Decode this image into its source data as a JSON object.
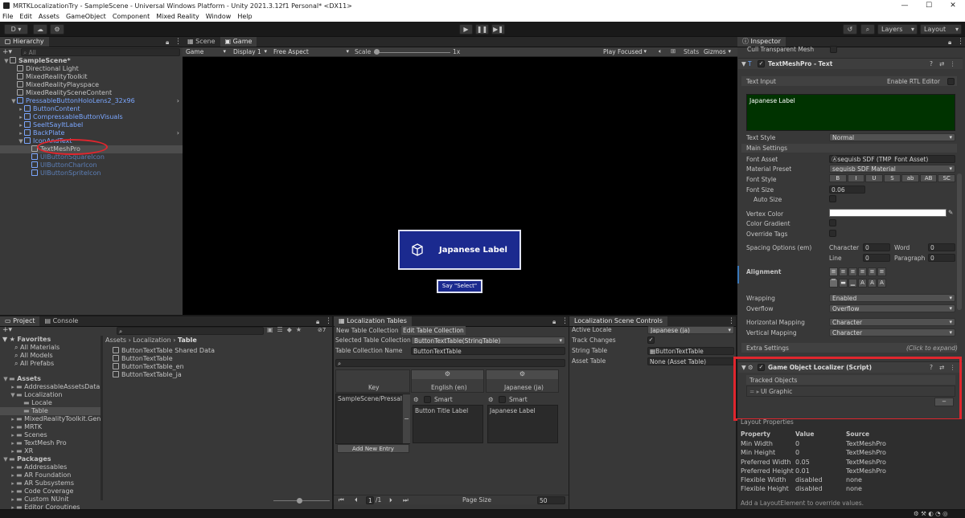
{
  "titlebar": {
    "title": "MRTKLocalizationTry - SampleScene - Universal Windows Platform - Unity 2021.3.12f1 Personal* <DX11>",
    "min": "—",
    "max": "☐",
    "close": "✕"
  },
  "menu": [
    "File",
    "Edit",
    "Assets",
    "GameObject",
    "Component",
    "Mixed Reality",
    "Window",
    "Help"
  ],
  "toolbar": {
    "account": "D ▾",
    "play": "▶",
    "pause": "❚❚",
    "step": "▶❚",
    "layers": "Layers",
    "layout": "Layout"
  },
  "hierarchy": {
    "tab": "Hierarchy",
    "search_placeholder": "All",
    "items": [
      {
        "label": "SampleScene*",
        "depth": 0,
        "color": "white",
        "bold": true
      },
      {
        "label": "Directional Light",
        "depth": 1,
        "color": "white"
      },
      {
        "label": "MixedRealityToolkit",
        "depth": 1,
        "color": "white"
      },
      {
        "label": "MixedRealityPlayspace",
        "depth": 1,
        "color": "white"
      },
      {
        "label": "MixedRealitySceneContent",
        "depth": 1,
        "color": "white"
      },
      {
        "label": "PressableButtonHoloLens2_32x96",
        "depth": 1,
        "color": "blue"
      },
      {
        "label": "ButtonContent",
        "depth": 2,
        "color": "blue"
      },
      {
        "label": "CompressableButtonVisuals",
        "depth": 2,
        "color": "blue"
      },
      {
        "label": "SeeItSayItLabel",
        "depth": 2,
        "color": "blue"
      },
      {
        "label": "BackPlate",
        "depth": 2,
        "color": "blue"
      },
      {
        "label": "IconAndText",
        "depth": 2,
        "color": "blue"
      },
      {
        "label": "TextMeshPro",
        "depth": 3,
        "color": "white",
        "selected": true
      },
      {
        "label": "UIButtonSquareIcon",
        "depth": 3,
        "color": "dim"
      },
      {
        "label": "UIButtonCharIcon",
        "depth": 3,
        "color": "dim"
      },
      {
        "label": "UIButtonSpriteIcon",
        "depth": 3,
        "color": "dim"
      }
    ]
  },
  "game": {
    "tabs": [
      "Scene",
      "Game"
    ],
    "display_mode": "Game",
    "display": "Display 1",
    "aspect": "Free Aspect",
    "scale_label": "Scale",
    "scale_value": "1x",
    "play_focused": "Play Focused",
    "stats": "Stats",
    "gizmos": "Gizmos",
    "button_label": "Japanese Label",
    "say_label": "Say \"Select\""
  },
  "project": {
    "tabs": [
      "Project",
      "Console"
    ],
    "breadcrumb": [
      "Assets",
      "Localization",
      "Table"
    ],
    "count": "7",
    "favorites": [
      "Favorites",
      "All Materials",
      "All Models",
      "All Prefabs"
    ],
    "tree": [
      {
        "label": "Assets",
        "depth": 0,
        "bold": true
      },
      {
        "label": "AddressableAssetsData",
        "depth": 1
      },
      {
        "label": "Localization",
        "depth": 1
      },
      {
        "label": "Locale",
        "depth": 2
      },
      {
        "label": "Table",
        "depth": 2,
        "selected": true
      },
      {
        "label": "MixedRealityToolkit.Gene",
        "depth": 1
      },
      {
        "label": "MRTK",
        "depth": 1
      },
      {
        "label": "Scenes",
        "depth": 1
      },
      {
        "label": "TextMesh Pro",
        "depth": 1
      },
      {
        "label": "XR",
        "depth": 1
      },
      {
        "label": "Packages",
        "depth": 0,
        "bold": true
      },
      {
        "label": "Addressables",
        "depth": 1
      },
      {
        "label": "AR Foundation",
        "depth": 1
      },
      {
        "label": "AR Subsystems",
        "depth": 1
      },
      {
        "label": "Code Coverage",
        "depth": 1
      },
      {
        "label": "Custom NUnit",
        "depth": 1
      },
      {
        "label": "Editor Coroutines",
        "depth": 1
      }
    ],
    "files": [
      "ButtonTextTable Shared Data",
      "ButtonTextTable",
      "ButtonTextTable_en",
      "ButtonTextTable_ja"
    ]
  },
  "loc_tables": {
    "tab": "Localization Tables",
    "subtabs": [
      "New Table Collection",
      "Edit Table Collection"
    ],
    "selected_collection_label": "Selected Table Collection",
    "selected_collection_value": "ButtonTextTable(StringTable)",
    "collection_name_label": "Table Collection Name",
    "collection_name_value": "ButtonTextTable",
    "col_key": "Key",
    "col_en": "English (en)",
    "col_ja": "Japanese (ja)",
    "smart": "Smart",
    "row_key": "SampleScene/Pressal",
    "row_en": "Button Title Label",
    "row_ja": "Japanese Label",
    "add_entry": "Add New Entry",
    "page": "1",
    "page_total": "/1",
    "page_size_label": "Page Size",
    "page_size": "50"
  },
  "scene_controls": {
    "tab": "Localization Scene Controls",
    "active_locale_label": "Active Locale",
    "active_locale": "Japanese (ja)",
    "track_changes_label": "Track Changes",
    "string_table_label": "String Table",
    "string_table": "ButtonTextTable",
    "asset_table_label": "Asset Table",
    "asset_table": "None (Asset Table)"
  },
  "inspector": {
    "tab": "Inspector",
    "cull": "Cull Transparent Mesh",
    "component": "TextMeshPro - Text",
    "text_input": "Text Input",
    "rtl": "Enable RTL Editor",
    "text_value": "Japanese Label",
    "text_style_label": "Text Style",
    "text_style": "Normal",
    "main_settings": "Main Settings",
    "font_asset_label": "Font Asset",
    "font_asset": "seguisb SDF (TMP_Font Asset)",
    "material_preset_label": "Material Preset",
    "material_preset": "seguisb SDF Material",
    "font_style_label": "Font Style",
    "font_style_buttons": [
      "B",
      "I",
      "U",
      "S",
      "ab",
      "AB",
      "SC"
    ],
    "font_size_label": "Font Size",
    "font_size": "0.06",
    "auto_size": "Auto Size",
    "vertex_color": "Vertex Color",
    "color_gradient": "Color Gradient",
    "override_tags": "Override Tags",
    "spacing_label": "Spacing Options (em)",
    "character": "Character",
    "character_val": "0",
    "word": "Word",
    "word_val": "0",
    "line": "Line",
    "line_val": "0",
    "paragraph": "Paragraph",
    "paragraph_val": "0",
    "alignment": "Alignment",
    "wrapping_label": "Wrapping",
    "wrapping": "Enabled",
    "overflow_label": "Overflow",
    "overflow": "Overflow",
    "hmap_label": "Horizontal Mapping",
    "hmap": "Character",
    "vmap_label": "Vertical Mapping",
    "vmap": "Character",
    "extra": "Extra Settings",
    "click_expand": "(Click to expand)",
    "localizer": "Game Object Localizer (Script)",
    "tracked": "Tracked Objects",
    "ui_graphic": "UI Graphic",
    "minus": "−",
    "layout_props": "Layout Properties",
    "lp_headers": [
      "Property",
      "Value",
      "Source"
    ],
    "lp_rows": [
      [
        "Min Width",
        "0",
        "TextMeshPro"
      ],
      [
        "Min Height",
        "0",
        "TextMeshPro"
      ],
      [
        "Preferred Width",
        "0.05",
        "TextMeshPro"
      ],
      [
        "Preferred Height",
        "0.01",
        "TextMeshPro"
      ],
      [
        "Flexible Width",
        "disabled",
        "none"
      ],
      [
        "Flexible Height",
        "disabled",
        "none"
      ]
    ],
    "footer": "Add a LayoutElement to override values."
  },
  "colors": {
    "highlight": "#e0262e",
    "selection": "#2c5d87",
    "button_bg": "#1b2a8f",
    "text_area": "#003300"
  }
}
